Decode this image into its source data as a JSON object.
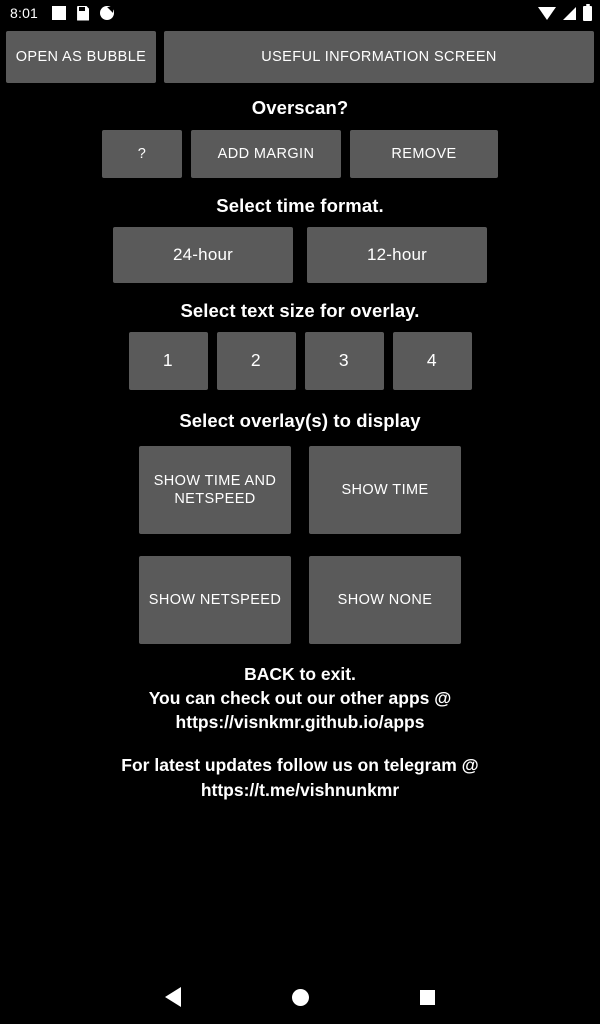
{
  "statusbar": {
    "time": "8:01",
    "left_icons": [
      "square-icon",
      "save-icon",
      "pie-icon"
    ],
    "right_icons": [
      "wifi-icon",
      "signal-icon",
      "battery-icon"
    ]
  },
  "topbar": {
    "open_as_bubble": "OPEN AS BUBBLE",
    "useful_information_screen": "USEFUL INFORMATION SCREEN"
  },
  "overscan": {
    "title": "Overscan?",
    "help": "?",
    "add_margin": "ADD MARGIN",
    "remove": "REMOVE"
  },
  "time_format": {
    "title": "Select time format.",
    "option_24": "24-hour",
    "option_12": "12-hour"
  },
  "text_size": {
    "title": "Select text size for overlay.",
    "options": [
      "1",
      "2",
      "3",
      "4"
    ]
  },
  "overlay": {
    "title": "Select overlay(s) to display",
    "show_time_and_netspeed": "SHOW TIME AND NETSPEED",
    "show_time": "SHOW TIME",
    "show_netspeed": "SHOW NETSPEED",
    "show_none": "SHOW NONE"
  },
  "footer": {
    "back_line": "BACK to exit.",
    "apps_line": "You can check out our other apps @",
    "apps_url": "https://visnkmr.github.io/apps",
    "telegram_line": "For latest updates follow us on telegram @",
    "telegram_url": "https://t.me/vishnunkmr"
  },
  "navbar": {
    "back": "back-icon",
    "home": "home-icon",
    "recent": "recents-icon"
  },
  "colors": {
    "background": "#000000",
    "button": "#5a5a5a",
    "text": "#ffffff"
  }
}
